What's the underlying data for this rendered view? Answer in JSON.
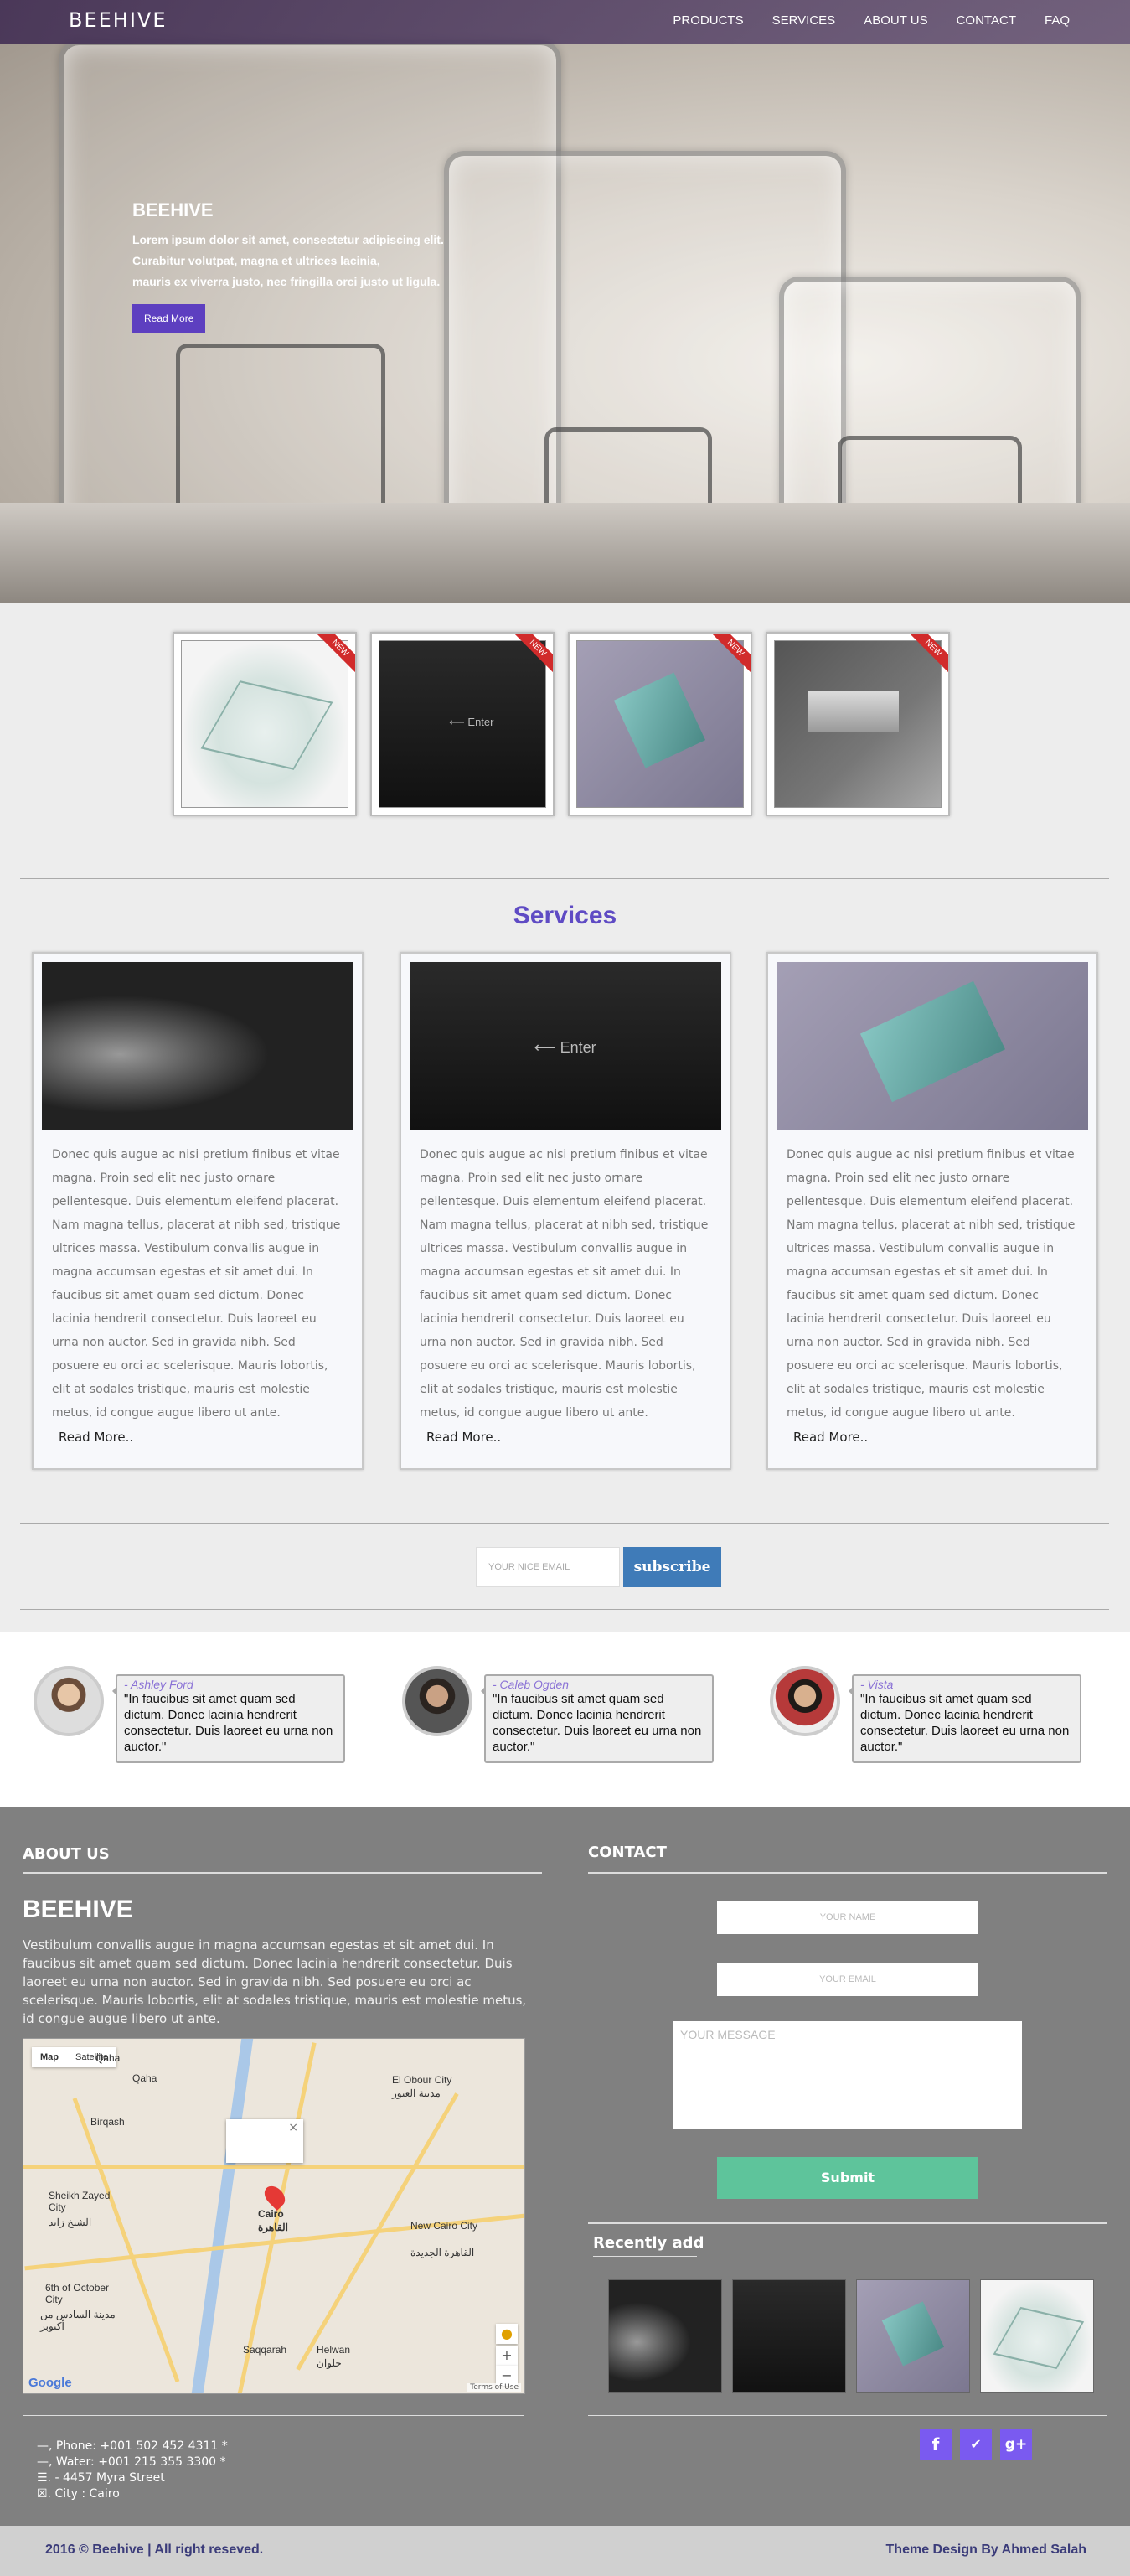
{
  "nav": {
    "logo": "BEEHIVE",
    "items": [
      "PRODUCTS",
      "SERVICES",
      "ABOUT US",
      "CONTACT",
      "FAQ"
    ]
  },
  "hero": {
    "title": "BEEHIVE",
    "lines": [
      "Lorem ipsum dolor sit amet, consectetur adipiscing elit.",
      "Curabitur volutpat, magna et ultrices lacinia,",
      "mauris ex viverra justo, nec fringilla orci justo ut ligula."
    ],
    "button": "Read More"
  },
  "thumbnails": {
    "badge": "NEW",
    "keyboard_key": "⟵ Enter",
    "images": [
      "glass-plate",
      "keyboard",
      "glass-stack",
      "glass-hinge"
    ]
  },
  "services": {
    "title": "Services",
    "cards": [
      {
        "image": "cat-computer",
        "text": "Donec quis augue ac nisi pretium finibus et vitae magna. Proin sed elit nec justo ornare pellentesque. Duis elementum eleifend placerat. Nam magna tellus, placerat at nibh sed, tristique ultrices massa. Vestibulum convallis augue in magna accumsan egestas et sit amet dui. In faucibus sit amet quam sed dictum. Donec lacinia hendrerit consectetur. Duis laoreet eu urna non auctor. Sed in gravida nibh. Sed posuere eu orci ac scelerisque. Mauris lobortis, elit at sodales tristique, mauris est molestie metus, id congue augue libero ut ante.",
        "more": "Read More.."
      },
      {
        "image": "keyboard",
        "text": "Donec quis augue ac nisi pretium finibus et vitae magna. Proin sed elit nec justo ornare pellentesque. Duis elementum eleifend placerat. Nam magna tellus, placerat at nibh sed, tristique ultrices massa. Vestibulum convallis augue in magna accumsan egestas et sit amet dui. In faucibus sit amet quam sed dictum. Donec lacinia hendrerit consectetur. Duis laoreet eu urna non auctor. Sed in gravida nibh. Sed posuere eu orci ac scelerisque. Mauris lobortis, elit at sodales tristique, mauris est molestie metus, id congue augue libero ut ante.",
        "more": "Read More.."
      },
      {
        "image": "glass-stack",
        "text": "Donec quis augue ac nisi pretium finibus et vitae magna. Proin sed elit nec justo ornare pellentesque. Duis elementum eleifend placerat. Nam magna tellus, placerat at nibh sed, tristique ultrices massa. Vestibulum convallis augue in magna accumsan egestas et sit amet dui. In faucibus sit amet quam sed dictum. Donec lacinia hendrerit consectetur. Duis laoreet eu urna non auctor. Sed in gravida nibh. Sed posuere eu orci ac scelerisque. Mauris lobortis, elit at sodales tristique, mauris est molestie metus, id congue augue libero ut ante.",
        "more": "Read More.."
      }
    ]
  },
  "subscribe": {
    "placeholder": "YOUR NICE EMAIL",
    "button": "subscribe"
  },
  "testimonials": [
    {
      "name": "- Ashley Ford",
      "quote": "\"In faucibus sit amet quam sed dictum. Donec lacinia hendrerit consectetur. Duis laoreet eu urna non auctor.\""
    },
    {
      "name": "- Caleb Ogden",
      "quote": "\"In faucibus sit amet quam sed dictum. Donec lacinia hendrerit consectetur. Duis laoreet eu urna non auctor.\""
    },
    {
      "name": "- Vista",
      "quote": "\"In faucibus sit amet quam sed dictum. Donec lacinia hendrerit consectetur. Duis laoreet eu urna non auctor.\""
    }
  ],
  "footer": {
    "about_heading": "ABOUT US",
    "brand": "BEEHIVE",
    "about_text": "Vestibulum convallis augue in magna accumsan egestas et sit amet dui. In faucibus sit amet quam sed dictum. Donec lacinia hendrerit consectetur. Duis laoreet eu urna non auctor. Sed in gravida nibh. Sed posuere eu orci ac scelerisque. Mauris lobortis, elit at sodales tristique, mauris est molestie metus, id congue augue libero ut ante.",
    "map": {
      "tab_map": "Map",
      "tab_satellite": "Satellite",
      "close": "×",
      "labels": {
        "cairo": "Cairo",
        "cairo_ar": "القاهرة",
        "obour": "El Obour City",
        "obour_ar": "مدينة العبور",
        "sheikh": "Sheikh Zayed City",
        "sheikh_ar": "الشيخ زايد",
        "october": "6th of October City",
        "october_ar": "مدينة السادس من أكتوبر",
        "new_cairo": "New Cairo City",
        "new_cairo_ar": "القاهرة الجديدة",
        "helwan": "Helwan",
        "helwan_ar": "حلوان",
        "saqqarah": "Saqqarah",
        "birqash": "Birqash",
        "qaha": "Qaha"
      },
      "zoom_in": "+",
      "zoom_out": "−",
      "brand": "Google",
      "terms": "Terms of Use"
    },
    "contact_heading": "CONTACT",
    "name_placeholder": "YOUR NAME",
    "email_placeholder": "YOUR EMAIL",
    "message_placeholder": "YOUR MESSAGE",
    "submit": "Submit",
    "recent_heading": "Recently add",
    "recent_images": [
      "cat-computer",
      "keyboard",
      "glass-stack",
      "glass-plate"
    ],
    "contact_lines": [
      "—, Phone: +001 502 452 4311 *",
      "—, Water: +001 215 355 3300 *",
      "☰. - 4457 Myra Street",
      "☒. City : Cairo"
    ],
    "social": [
      {
        "icon": "facebook-icon",
        "glyph": "f"
      },
      {
        "icon": "twitter-icon",
        "glyph": "✔"
      },
      {
        "icon": "google-plus-icon",
        "glyph": "g+"
      }
    ]
  },
  "bottom": {
    "copyright": "2016 © Beehive | All right reseved.",
    "credit": "Theme Design By Ahmed Salah"
  },
  "colors": {
    "accent": "#5f4bc4",
    "button_purple": "#5d3fc0",
    "subscribe_blue": "#3f7bb8",
    "submit_green": "#5ec49b",
    "footer_bg": "#808080",
    "social": "#7a5af0",
    "ribbon": "#d12b2b"
  }
}
